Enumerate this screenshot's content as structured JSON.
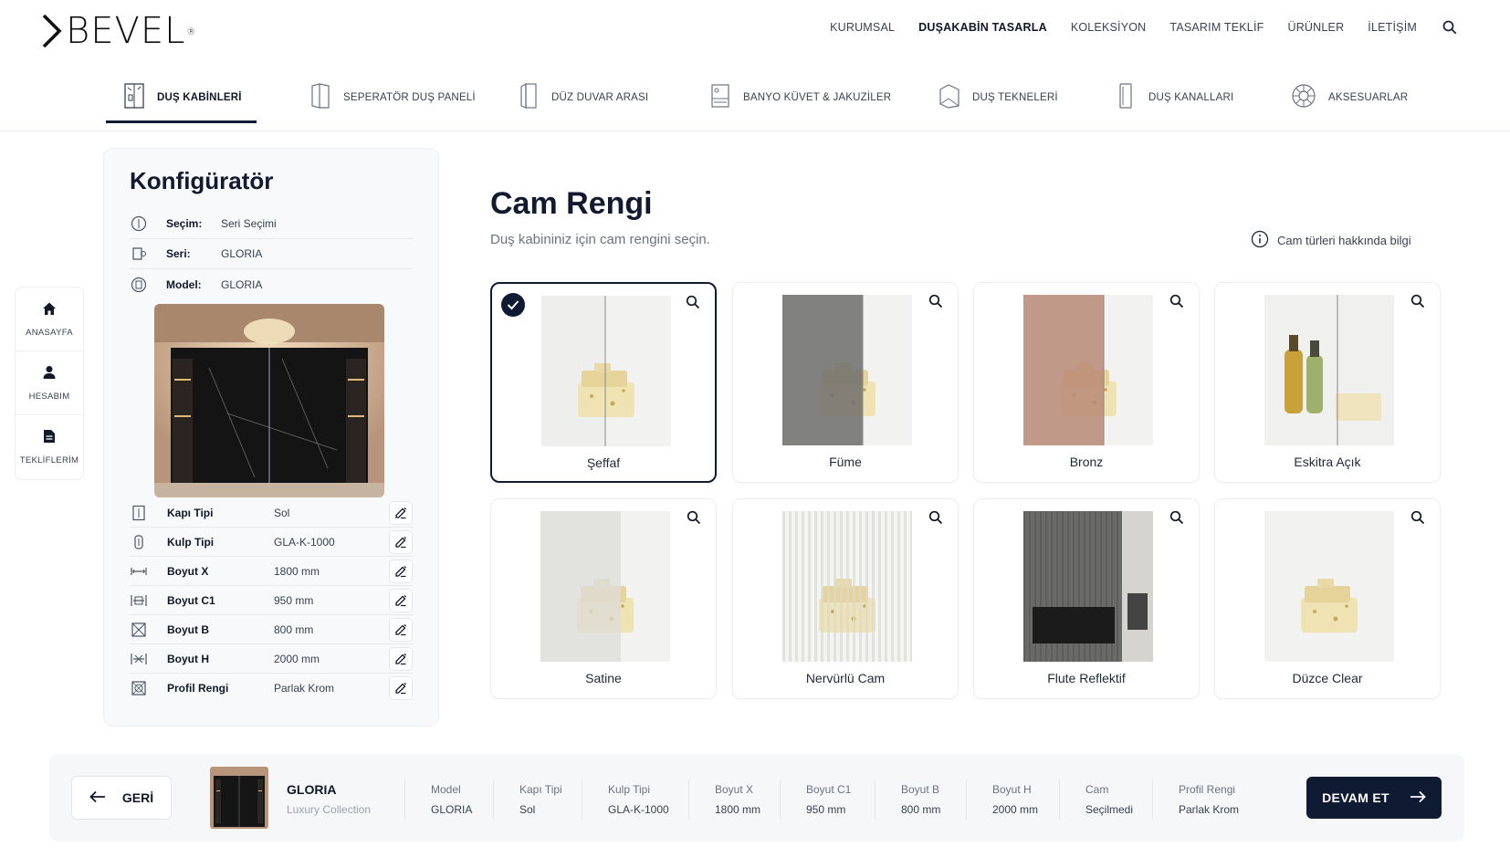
{
  "brand": {
    "logo_text": "BEVEL",
    "logo_mark": "®"
  },
  "topnav": [
    {
      "label": "KURUMSAL",
      "active": false
    },
    {
      "label": "DUŞAKABİN TASARLA",
      "active": true
    },
    {
      "label": "KOLEKSİYON",
      "active": false
    },
    {
      "label": "TASARIM TEKLİF",
      "active": false
    },
    {
      "label": "ÜRÜNLER",
      "active": false
    },
    {
      "label": "İLETİŞİM",
      "active": false
    }
  ],
  "categories": [
    {
      "label": "DUŞ KABİNLERİ",
      "icon": "shower-cabin-icon",
      "active": true
    },
    {
      "label": "SEPERATÖR DUŞ PANELİ",
      "icon": "separator-panel-icon",
      "active": false
    },
    {
      "label": "DÜZ DUVAR ARASI",
      "icon": "wall-niche-icon",
      "active": false
    },
    {
      "label": "BANYO KÜVET & JAKUZİLER",
      "icon": "bathtub-icon",
      "active": false
    },
    {
      "label": "DUŞ TEKNELERİ",
      "icon": "shower-tray-icon",
      "active": false
    },
    {
      "label": "DUŞ KANALLARI",
      "icon": "shower-channel-icon",
      "active": false
    },
    {
      "label": "AKSESUARLAR",
      "icon": "accessories-icon",
      "active": false
    }
  ],
  "rail": [
    {
      "label": "ANASAYFA",
      "icon": "home-icon"
    },
    {
      "label": "HESABIM",
      "icon": "user-icon"
    },
    {
      "label": "TEKLİFLERİM",
      "icon": "document-icon"
    }
  ],
  "configurator": {
    "title": "Konfigüratör",
    "info": [
      {
        "key": "Seçim:",
        "value": "Seri Seçimi",
        "icon": "selection-icon"
      },
      {
        "key": "Seri:",
        "value": "GLORIA",
        "icon": "series-icon"
      },
      {
        "key": "Model:",
        "value": "GLORIA",
        "icon": "model-icon"
      }
    ],
    "specs": [
      {
        "key": "Kapı Tipi",
        "value": "Sol",
        "icon": "door-type-icon"
      },
      {
        "key": "Kulp Tipi",
        "value": "GLA-K-1000",
        "icon": "handle-icon"
      },
      {
        "key": "Boyut X",
        "value": "1800 mm",
        "icon": "dimension-x-icon"
      },
      {
        "key": "Boyut C1",
        "value": "950 mm",
        "icon": "dimension-c1-icon"
      },
      {
        "key": "Boyut B",
        "value": "800 mm",
        "icon": "dimension-b-icon"
      },
      {
        "key": "Boyut H",
        "value": "2000 mm",
        "icon": "dimension-h-icon"
      },
      {
        "key": "Profil Rengi",
        "value": "Parlak Krom",
        "icon": "profile-color-icon"
      }
    ]
  },
  "main": {
    "title": "Cam Rengi",
    "subtitle": "Duş kabininiz için cam rengini seçin.",
    "info_link": "Cam türleri hakkında bilgi"
  },
  "glass_options": [
    {
      "label": "Şeffaf",
      "selected": true,
      "tint": "#e7e7e5",
      "style": "split"
    },
    {
      "label": "Füme",
      "selected": false,
      "tint": "#6d6d6b",
      "style": "split"
    },
    {
      "label": "Bronz",
      "selected": false,
      "tint": "#b88a76",
      "style": "split"
    },
    {
      "label": "Eskitra Açık",
      "selected": false,
      "tint": "#e9e9e6",
      "style": "bottles"
    },
    {
      "label": "Satine",
      "selected": false,
      "tint": "#d7d8d6",
      "style": "frosted"
    },
    {
      "label": "Nervürlü Cam",
      "selected": false,
      "tint": "#eeeeec",
      "style": "ribbed"
    },
    {
      "label": "Flute Reflektif",
      "selected": false,
      "tint": "#2a2a2a",
      "style": "interior"
    },
    {
      "label": "Düzce Clear",
      "selected": false,
      "tint": "#ececea",
      "style": "plain"
    }
  ],
  "summary": {
    "back_label": "GERİ",
    "series_name": "GLORIA",
    "series_sub": "Luxury Collection",
    "items": [
      {
        "key": "Model",
        "value": "GLORIA"
      },
      {
        "key": "Kapı Tipi",
        "value": "Sol"
      },
      {
        "key": "Kulp Tipi",
        "value": "GLA-K-1000"
      },
      {
        "key": "Boyut X",
        "value": "1800 mm"
      },
      {
        "key": "Boyut C1",
        "value": "950 mm"
      },
      {
        "key": "Boyut B",
        "value": "800 mm"
      },
      {
        "key": "Boyut H",
        "value": "2000 mm"
      },
      {
        "key": "Cam",
        "value": "Seçilmedi"
      },
      {
        "key": "Profil Rengi",
        "value": "Parlak Krom"
      }
    ],
    "next_label": "DEVAM ET"
  },
  "colors": {
    "navy": "#0f1a33",
    "border": "#eceef2",
    "panel_bg": "#f8f9fb"
  }
}
